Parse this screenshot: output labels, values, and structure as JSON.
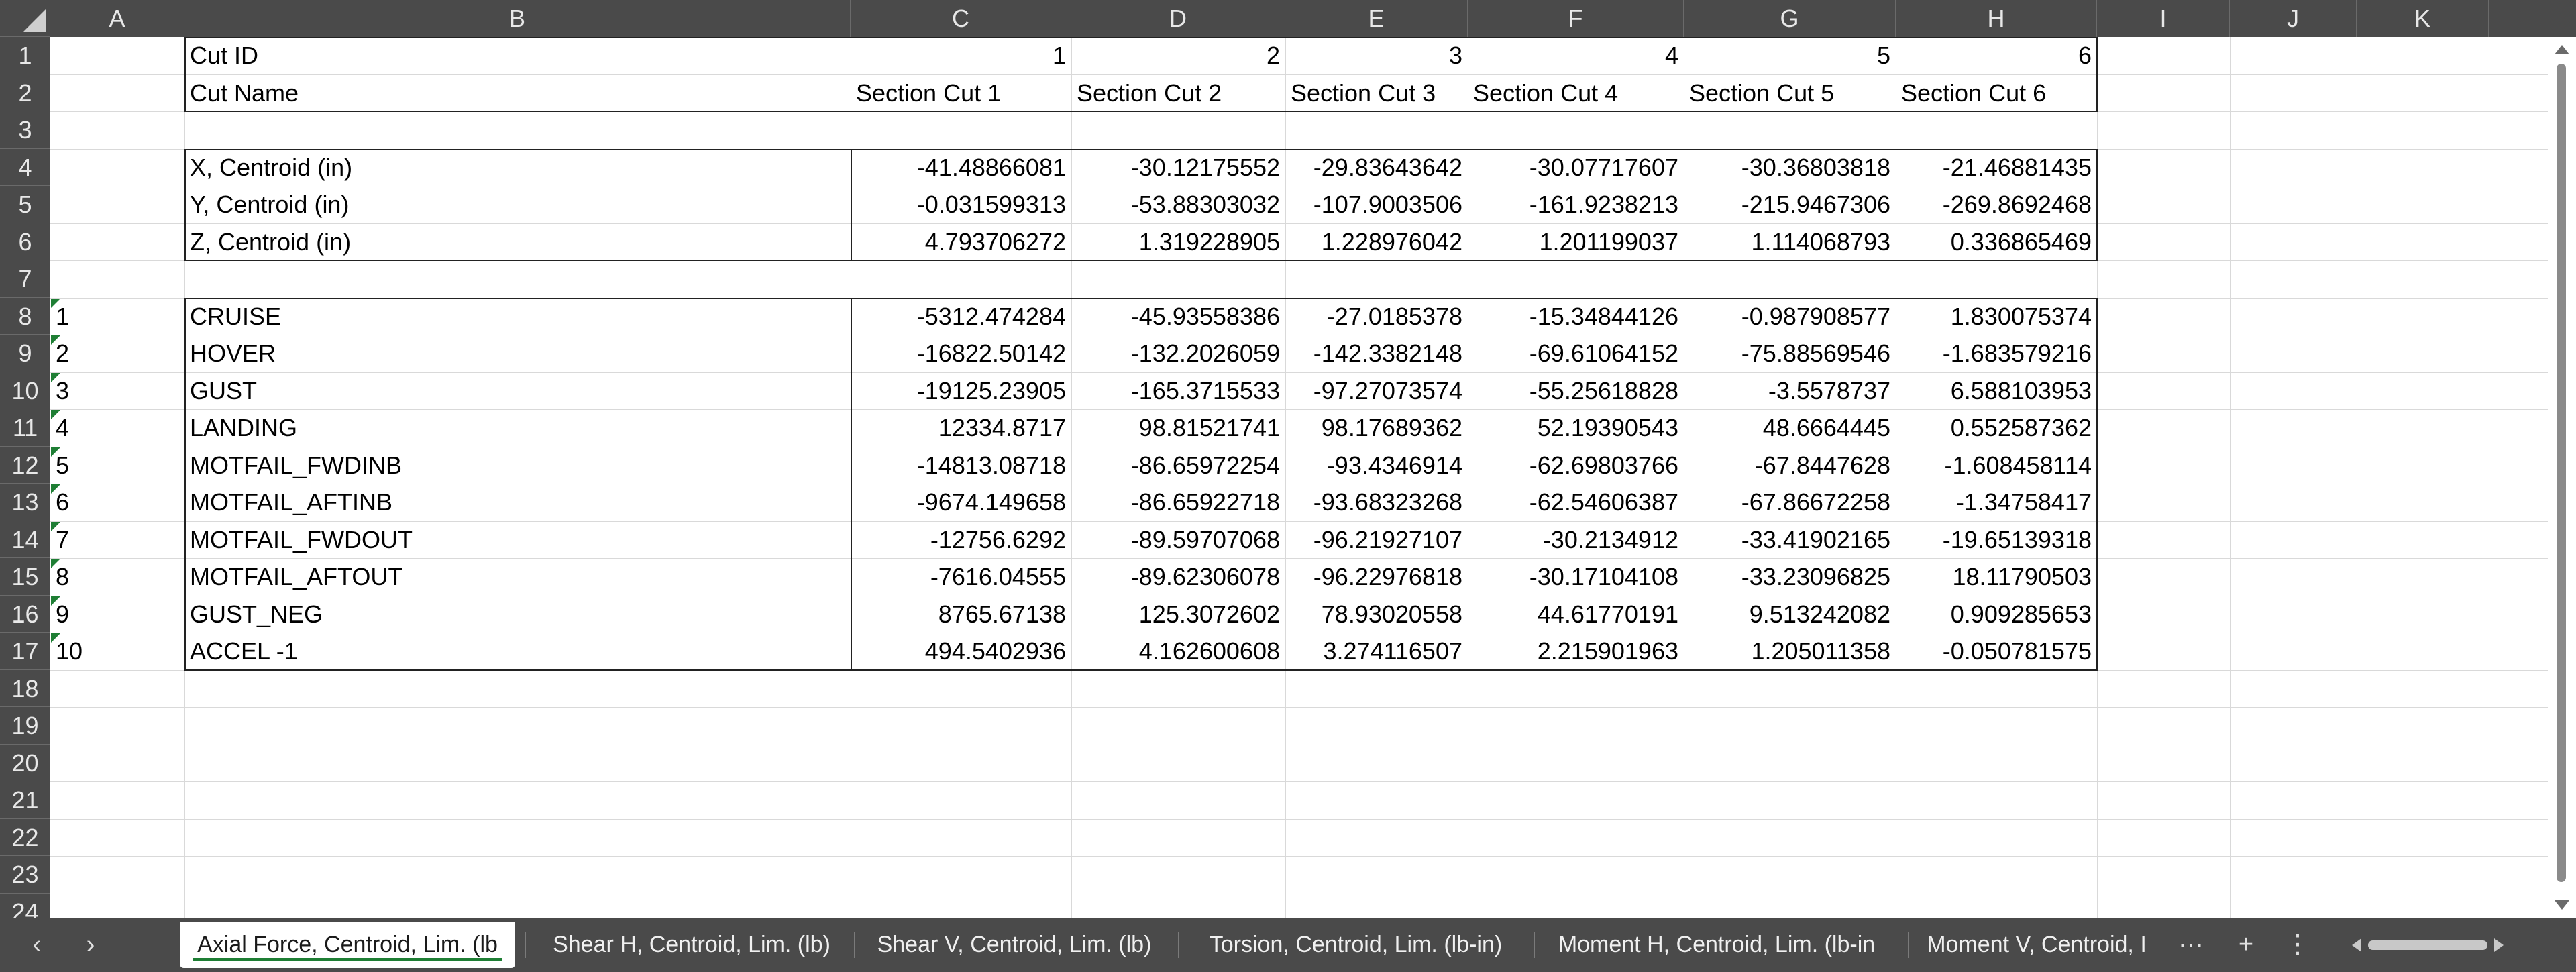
{
  "columns": [
    "A",
    "B",
    "C",
    "D",
    "E",
    "F",
    "G",
    "H",
    "I",
    "J",
    "K"
  ],
  "rows": [
    "1",
    "2",
    "3",
    "4",
    "5",
    "6",
    "7",
    "8",
    "9",
    "10",
    "11",
    "12",
    "13",
    "14",
    "15",
    "16",
    "17",
    "18",
    "19",
    "20",
    "21",
    "22",
    "23",
    "24"
  ],
  "header": {
    "cut_id_label": "Cut ID",
    "cut_ids": [
      "1",
      "2",
      "3",
      "4",
      "5",
      "6"
    ],
    "cut_name_label": "Cut Name",
    "cut_names": [
      "Section Cut 1",
      "Section Cut 2",
      "Section Cut 3",
      "Section Cut 4",
      "Section Cut 5",
      "Section Cut 6"
    ]
  },
  "centroids": [
    {
      "label": "X, Centroid (in)",
      "values": [
        "-41.48866081",
        "-30.12175552",
        "-29.83643642",
        "-30.07717607",
        "-30.36803818",
        "-21.46881435"
      ]
    },
    {
      "label": "Y, Centroid (in)",
      "values": [
        "-0.031599313",
        "-53.88303032",
        "-107.9003506",
        "-161.9238213",
        "-215.9467306",
        "-269.8692468"
      ]
    },
    {
      "label": "Z, Centroid (in)",
      "values": [
        "4.793706272",
        "1.319228905",
        "1.228976042",
        "1.201199037",
        "1.114068793",
        "0.336865469"
      ]
    }
  ],
  "loadcases": [
    {
      "id": "1",
      "name": "CRUISE",
      "values": [
        "-5312.474284",
        "-45.93558386",
        "-27.0185378",
        "-15.34844126",
        "-0.987908577",
        "1.830075374"
      ]
    },
    {
      "id": "2",
      "name": "HOVER",
      "values": [
        "-16822.50142",
        "-132.2026059",
        "-142.3382148",
        "-69.61064152",
        "-75.88569546",
        "-1.683579216"
      ]
    },
    {
      "id": "3",
      "name": "GUST",
      "values": [
        "-19125.23905",
        "-165.3715533",
        "-97.27073574",
        "-55.25618828",
        "-3.5578737",
        "6.588103953"
      ]
    },
    {
      "id": "4",
      "name": "LANDING",
      "values": [
        "12334.8717",
        "98.81521741",
        "98.17689362",
        "52.19390543",
        "48.6664445",
        "0.552587362"
      ]
    },
    {
      "id": "5",
      "name": "MOTFAIL_FWDINB",
      "values": [
        "-14813.08718",
        "-86.65972254",
        "-93.4346914",
        "-62.69803766",
        "-67.8447628",
        "-1.608458114"
      ]
    },
    {
      "id": "6",
      "name": "MOTFAIL_AFTINB",
      "values": [
        "-9674.149658",
        "-86.65922718",
        "-93.68323268",
        "-62.54606387",
        "-67.86672258",
        "-1.34758417"
      ]
    },
    {
      "id": "7",
      "name": "MOTFAIL_FWDOUT",
      "values": [
        "-12756.6292",
        "-89.59707068",
        "-96.21927107",
        "-30.2134912",
        "-33.41902165",
        "-19.65139318"
      ]
    },
    {
      "id": "8",
      "name": "MOTFAIL_AFTOUT",
      "values": [
        "-7616.04555",
        "-89.62306078",
        "-96.22976818",
        "-30.17104108",
        "-33.23096825",
        "18.11790503"
      ]
    },
    {
      "id": "9",
      "name": "GUST_NEG",
      "values": [
        "8765.67138",
        "125.3072602",
        "78.93020558",
        "44.61770191",
        "9.513242082",
        "0.909285653"
      ]
    },
    {
      "id": "10",
      "name": "ACCEL -1",
      "values": [
        "494.5402936",
        "4.162600608",
        "3.274116507",
        "2.215901963",
        "1.205011358",
        "-0.050781575"
      ]
    }
  ],
  "tabs": [
    "Axial Force, Centroid, Lim. (lb",
    "Shear H, Centroid, Lim. (lb)",
    "Shear V, Centroid, Lim. (lb)",
    "Torsion, Centroid, Lim. (lb-in)",
    "Moment H, Centroid, Lim. (lb-in",
    "Moment V, Centroid, I"
  ],
  "tab_controls": {
    "prev": "‹",
    "next": "›",
    "more": "···",
    "add": "+",
    "menu": "⋮"
  },
  "colors": {
    "accent": "#1e7e34",
    "header_bg": "#4a4a4a",
    "gridline": "#d9d9d9"
  }
}
